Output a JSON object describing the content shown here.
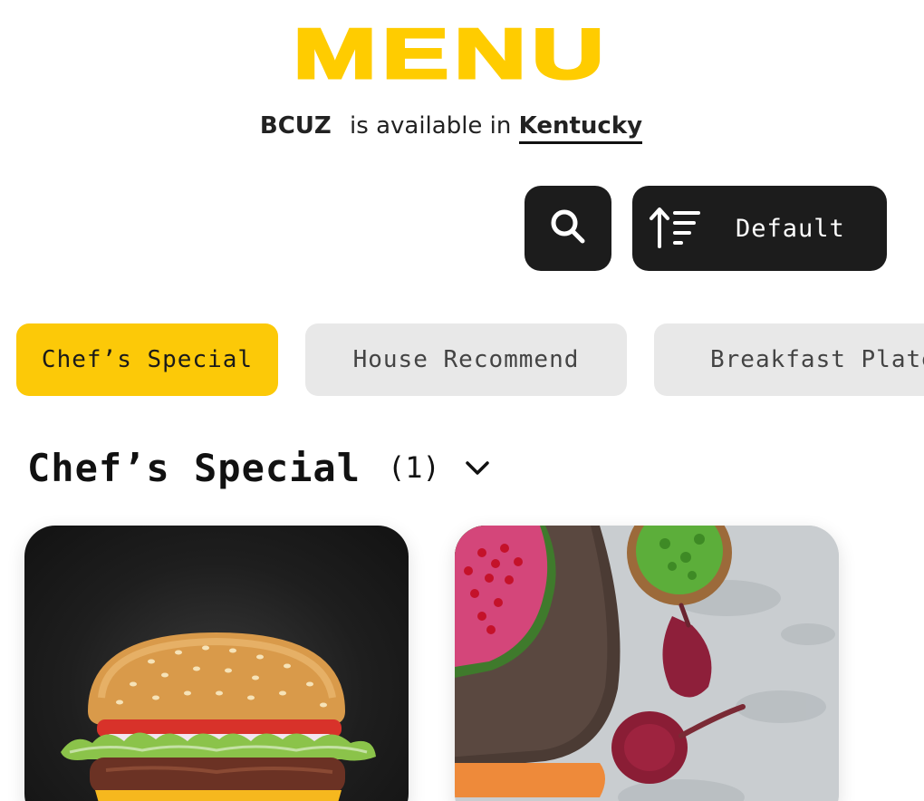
{
  "header": {
    "title": "MENU",
    "brand": "BCUZ",
    "availability_text": "is available in",
    "location": "Kentucky"
  },
  "toolbar": {
    "search_icon": "search-icon",
    "sort_icon": "sort-ascending-icon",
    "sort_label": "Default"
  },
  "categories": [
    {
      "label": "Chef’s Special",
      "active": true
    },
    {
      "label": "House Recommend",
      "active": false
    },
    {
      "label": "Breakfast Plate",
      "active": false
    }
  ],
  "section": {
    "title": "Chef’s Special",
    "count": "(1)",
    "toggle_icon": "chevron-down-icon"
  },
  "colors": {
    "accent": "#FCC908",
    "dark": "#1C1C1C",
    "chip_inactive": "#E8E8E8"
  }
}
